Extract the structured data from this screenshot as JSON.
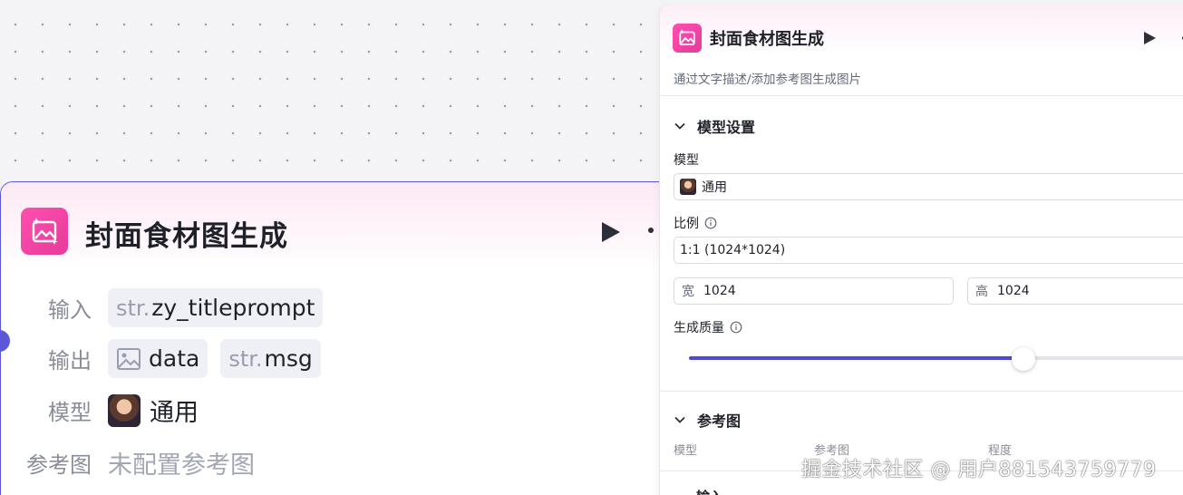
{
  "node": {
    "title": "封面食材图生成",
    "input_label": "输入",
    "inputs": [
      {
        "type": "str.",
        "name": "zy_titleprompt"
      }
    ],
    "output_label": "输出",
    "outputs": [
      {
        "type": "",
        "name": "data",
        "icon": "image-icon"
      },
      {
        "type": "str.",
        "name": "msg"
      }
    ],
    "model_label": "模型",
    "model_value": "通用",
    "reference_label": "参考图",
    "reference_value": "未配置参考图"
  },
  "panel": {
    "title": "封面食材图生成",
    "description": "通过文字描述/添加参考图生成图片",
    "model_section": {
      "title": "模型设置",
      "model_label": "模型",
      "model_value": "通用",
      "ratio_label": "比例",
      "ratio_value": "1:1 (1024*1024)",
      "width_label": "宽",
      "width_value": "1024",
      "height_label": "高",
      "height_value": "1024",
      "quality_label": "生成质量",
      "quality_fraction": 0.62
    },
    "reference_section": {
      "title": "参考图",
      "col_model": "模型",
      "col_reference": "参考图",
      "col_degree": "程度"
    },
    "input_section_title": "输入"
  },
  "watermark": "掘金技术社区 @ 用户881543759779",
  "colors": {
    "accent": "#5b57d9",
    "brand_pink": "#e83f9f",
    "slider_fill": "#4e4bd0"
  }
}
